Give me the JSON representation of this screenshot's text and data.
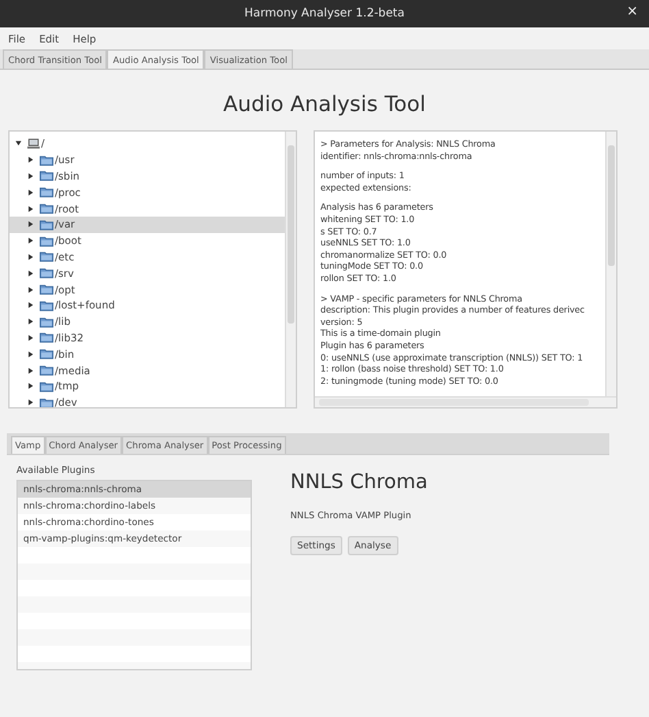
{
  "window": {
    "title": "Harmony Analyser 1.2-beta",
    "close": "×"
  },
  "menu": [
    "File",
    "Edit",
    "Help"
  ],
  "tabs": [
    {
      "label": "Chord Transition Tool",
      "selected": false
    },
    {
      "label": "Audio Analysis Tool",
      "selected": true
    },
    {
      "label": "Visualization Tool",
      "selected": false
    }
  ],
  "heading": "Audio Analysis Tool",
  "tree": {
    "label": "/",
    "expanded": true,
    "children": [
      {
        "label": "/usr",
        "selected": false
      },
      {
        "label": "/sbin",
        "selected": false
      },
      {
        "label": "/proc",
        "selected": false
      },
      {
        "label": "/root",
        "selected": false
      },
      {
        "label": "/var",
        "selected": true
      },
      {
        "label": "/boot",
        "selected": false
      },
      {
        "label": "/etc",
        "selected": false
      },
      {
        "label": "/srv",
        "selected": false
      },
      {
        "label": "/opt",
        "selected": false
      },
      {
        "label": "/lost+found",
        "selected": false
      },
      {
        "label": "/lib",
        "selected": false
      },
      {
        "label": "/lib32",
        "selected": false
      },
      {
        "label": "/bin",
        "selected": false
      },
      {
        "label": "/media",
        "selected": false
      },
      {
        "label": "/tmp",
        "selected": false
      },
      {
        "label": "/dev",
        "selected": false
      }
    ]
  },
  "output": [
    [
      "> Parameters for Analysis: NNLS Chroma",
      "identifier: nnls-chroma:nnls-chroma"
    ],
    [
      "number of inputs: 1",
      "expected extensions:"
    ],
    [
      "Analysis has 6 parameters",
      "whitening SET TO: 1.0",
      "s SET TO: 0.7",
      "useNNLS SET TO: 1.0",
      "chromanormalize SET TO: 0.0",
      "tuningMode SET TO: 0.0",
      "rollon SET TO: 1.0"
    ],
    [
      "> VAMP - specific parameters for NNLS Chroma",
      "description: This plugin provides a number of features derivec",
      "version: 5",
      "This is a time-domain plugin",
      "Plugin has 6 parameters",
      "0: useNNLS (use approximate transcription (NNLS)) SET TO: 1",
      "1: rollon (bass noise threshold) SET TO: 1.0",
      "2: tuningmode (tuning mode) SET TO: 0.0"
    ]
  ],
  "lower_tabs": [
    {
      "label": "Vamp",
      "selected": true
    },
    {
      "label": "Chord Analyser",
      "selected": false
    },
    {
      "label": "Chroma Analyser",
      "selected": false
    },
    {
      "label": "Post Processing",
      "selected": false
    }
  ],
  "plugins_label": "Available Plugins",
  "plugins": [
    {
      "label": "nnls-chroma:nnls-chroma",
      "selected": true
    },
    {
      "label": "nnls-chroma:chordino-labels",
      "selected": false
    },
    {
      "label": "nnls-chroma:chordino-tones",
      "selected": false
    },
    {
      "label": "qm-vamp-plugins:qm-keydetector",
      "selected": false
    }
  ],
  "plugin_title": "NNLS Chroma",
  "plugin_description": "NNLS Chroma VAMP Plugin",
  "buttons": [
    "Settings",
    "Analyse"
  ]
}
